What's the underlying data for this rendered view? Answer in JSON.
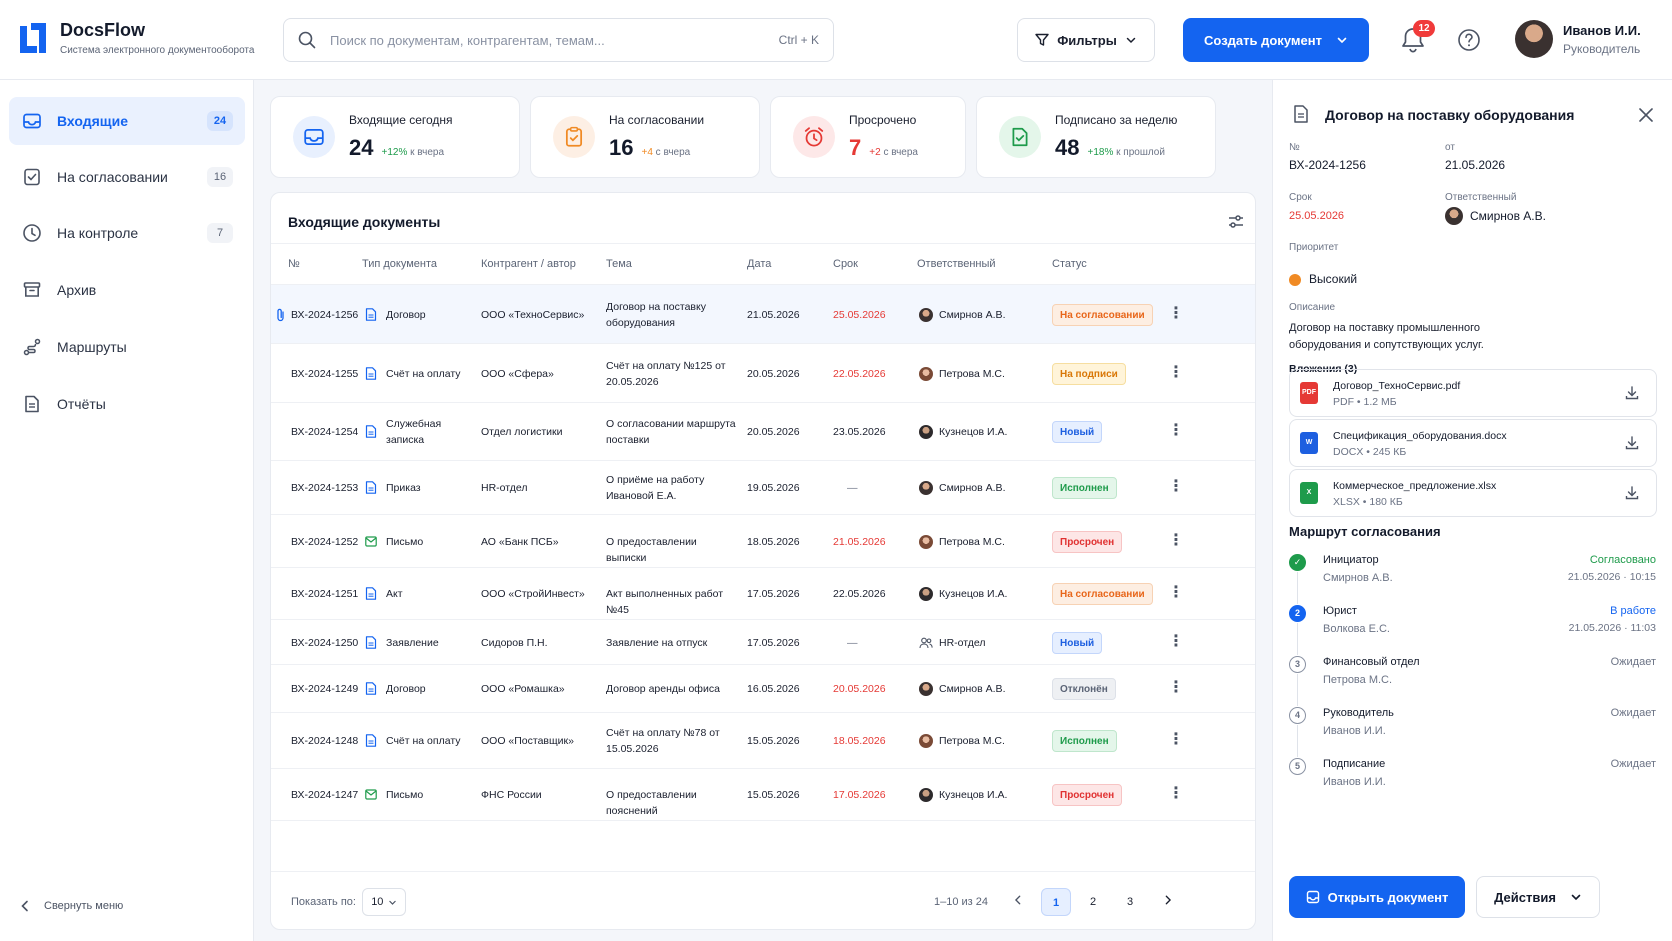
{
  "app": {
    "name": "DocsFlow",
    "subtitle": "Система электронного документооборота"
  },
  "header": {
    "search_placeholder": "Поиск по документам, контрагентам, темам...",
    "search_shortcut": "Ctrl + K",
    "filters_label": "Фильтры",
    "create_label": "Создать документ",
    "notifications_count": "12",
    "user_name": "Иванов И.И.",
    "user_role": "Руководитель"
  },
  "sidebar": {
    "items": [
      {
        "label": "Входящие",
        "count": "24",
        "icon": "inbox-icon",
        "active": true
      },
      {
        "label": "На согласовании",
        "count": "16",
        "icon": "check-square-icon"
      },
      {
        "label": "На контроле",
        "count": "7",
        "icon": "clock-icon"
      },
      {
        "label": "Архив",
        "count": "",
        "icon": "archive-icon"
      },
      {
        "label": "Маршруты",
        "count": "",
        "icon": "route-icon"
      },
      {
        "label": "Отчёты",
        "count": "",
        "icon": "report-icon"
      }
    ],
    "collapse_label": "Свернуть меню"
  },
  "stats": [
    {
      "label": "Входящие сегодня",
      "value": "24",
      "delta": "+12%",
      "delta_text": "к вчера",
      "color": "#1464f0",
      "value_color": "#131a2b"
    },
    {
      "label": "На согласовании",
      "value": "16",
      "delta": "+4",
      "delta_text": "с вчера",
      "color": "#f08a24",
      "value_color": "#131a2b"
    },
    {
      "label": "Просрочено",
      "value": "7",
      "delta": "+2",
      "delta_text": "с вчера",
      "color": "#e53935",
      "value_color": "#e53935"
    },
    {
      "label": "Подписано за неделю",
      "value": "48",
      "delta": "+18%",
      "delta_text": "к прошлой",
      "color": "#1e9b4b",
      "value_color": "#131a2b"
    }
  ],
  "table": {
    "title": "Входящие документы",
    "columns": [
      "№",
      "Тип документа",
      "Контрагент / автор",
      "Тема",
      "Дата",
      "Срок",
      "Ответственный",
      "Статус"
    ],
    "rows": [
      {
        "num": "ВХ-2024-1256",
        "type": "Договор",
        "type_icon": "doc-icon",
        "party": "ООО «ТехноСервис»",
        "subject": "Договор на поставку оборудования",
        "date": "21.05.2026",
        "due": "25.05.2026",
        "due_red": true,
        "owner": "Смирнов А.В.",
        "owner_kind": "male",
        "status": "На согласовании",
        "status_kind": "orange",
        "pinned": true
      },
      {
        "num": "ВХ-2024-1255",
        "type": "Счёт на оплату",
        "type_icon": "doc-icon",
        "party": "ООО «Сфера»",
        "subject": "Счёт на оплату №125 от 20.05.2026",
        "date": "20.05.2026",
        "due": "22.05.2026",
        "due_red": true,
        "owner": "Петрова М.С.",
        "owner_kind": "female",
        "status": "На подписи",
        "status_kind": "yellow"
      },
      {
        "num": "ВХ-2024-1254",
        "type": "Служебная записка",
        "type_icon": "doc-icon",
        "party": "Отдел логистики",
        "subject": "О согласовании маршрута поставки",
        "date": "20.05.2026",
        "due": "23.05.2026",
        "due_red": false,
        "owner": "Кузнецов И.А.",
        "owner_kind": "male2",
        "status": "Новый",
        "status_kind": "blue"
      },
      {
        "num": "ВХ-2024-1253",
        "type": "Приказ",
        "type_icon": "doc-icon",
        "party": "HR-отдел",
        "subject": "О приёме на работу Ивановой Е.А.",
        "date": "19.05.2026",
        "due": "—",
        "due_red": false,
        "owner": "Смирнов А.В.",
        "owner_kind": "male",
        "status": "Исполнен",
        "status_kind": "green"
      },
      {
        "num": "ВХ-2024-1252",
        "type": "Письмо",
        "type_icon": "mail-icon",
        "party": "АО «Банк ПСБ»",
        "subject": "О предоставлении выписки",
        "date": "18.05.2026",
        "due": "21.05.2026",
        "due_red": true,
        "owner": "Петрова М.С.",
        "owner_kind": "female",
        "status": "Просрочен",
        "status_kind": "red"
      },
      {
        "num": "ВХ-2024-1251",
        "type": "Акт",
        "type_icon": "doc-icon",
        "party": "ООО «СтройИнвест»",
        "subject": "Акт выполненных работ №45",
        "date": "17.05.2026",
        "due": "22.05.2026",
        "due_red": false,
        "owner": "Кузнецов И.А.",
        "owner_kind": "male2",
        "status": "На согласовании",
        "status_kind": "orange"
      },
      {
        "num": "ВХ-2024-1250",
        "type": "Заявление",
        "type_icon": "doc-icon",
        "party": "Сидоров П.Н.",
        "subject": "Заявление на отпуск",
        "date": "17.05.2026",
        "due": "—",
        "due_red": false,
        "owner": "HR-отдел",
        "owner_kind": "group",
        "status": "Новый",
        "status_kind": "blue"
      },
      {
        "num": "ВХ-2024-1249",
        "type": "Договор",
        "type_icon": "doc-icon",
        "party": "ООО «Ромашка»",
        "subject": "Договор аренды офиса",
        "date": "16.05.2026",
        "due": "20.05.2026",
        "due_red": true,
        "owner": "Смирнов А.В.",
        "owner_kind": "male",
        "status": "Отклонён",
        "status_kind": "gray"
      },
      {
        "num": "ВХ-2024-1248",
        "type": "Счёт на оплату",
        "type_icon": "doc-icon",
        "party": "ООО «Поставщик»",
        "subject": "Счёт на оплату №78 от 15.05.2026",
        "date": "15.05.2026",
        "due": "18.05.2026",
        "due_red": true,
        "owner": "Петрова М.С.",
        "owner_kind": "female",
        "status": "Исполнен",
        "status_kind": "green"
      },
      {
        "num": "ВХ-2024-1247",
        "type": "Письмо",
        "type_icon": "mail-icon",
        "party": "ФНС России",
        "subject": "О предоставлении пояснений",
        "date": "15.05.2026",
        "due": "17.05.2026",
        "due_red": true,
        "owner": "Кузнецов И.А.",
        "owner_kind": "male2",
        "status": "Просрочен",
        "status_kind": "red"
      }
    ],
    "show_label": "Показать по:",
    "per_page": "10",
    "range": "1–10 из 24",
    "pages": [
      "1",
      "2",
      "3"
    ],
    "current_page": "1"
  },
  "panel": {
    "title": "Договор на поставку оборудования",
    "num_label": "№",
    "num": "ВХ-2024-1256",
    "from_label": "от",
    "from": "21.05.2026",
    "due_label": "Срок",
    "due": "25.05.2026",
    "owner_label": "Ответственный",
    "owner": "Смирнов А.В.",
    "priority_label": "Приоритет",
    "priority": "Высокий",
    "desc_label": "Описание",
    "desc": "Договор на поставку промышленного оборудования и сопутствующих услуг.",
    "attachments_label": "Вложения (3)",
    "attachments": [
      {
        "name": "Договор_ТехноСервис.pdf",
        "meta": "PDF • 1.2 МБ",
        "kind": "PDF",
        "color": "#e53935"
      },
      {
        "name": "Спецификация_оборудования.docx",
        "meta": "DOCX • 245 КБ",
        "kind": "W",
        "color": "#1d5fe0"
      },
      {
        "name": "Коммерческое_предложение.xlsx",
        "meta": "XLSX • 180 КБ",
        "kind": "X",
        "color": "#1e9b4b"
      }
    ],
    "route_label": "Маршрут согласования",
    "route": [
      {
        "step": "✓",
        "name": "Инициатор",
        "person": "Смирнов А.В.",
        "status": "Согласовано",
        "time": "21.05.2026 · 10:15",
        "state": "done"
      },
      {
        "step": "2",
        "name": "Юрист",
        "person": "Волкова Е.С.",
        "status": "В работе",
        "time": "21.05.2026 · 11:03",
        "state": "active"
      },
      {
        "step": "3",
        "name": "Финансовый отдел",
        "person": "Петрова М.С.",
        "status": "Ожидает",
        "time": "",
        "state": "pending"
      },
      {
        "step": "4",
        "name": "Руководитель",
        "person": "Иванов И.И.",
        "status": "Ожидает",
        "time": "",
        "state": "pending"
      },
      {
        "step": "5",
        "name": "Подписание",
        "person": "Иванов И.И.",
        "status": "Ожидает",
        "time": "",
        "state": "pending"
      }
    ],
    "open_label": "Открыть документ",
    "actions_label": "Действия"
  }
}
